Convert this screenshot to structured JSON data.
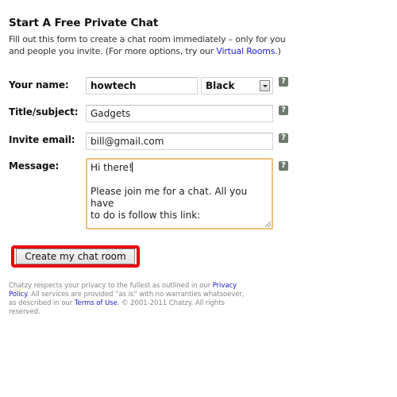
{
  "header": {
    "title": "Start A Free Private Chat",
    "intro_line1": "Fill out this form to create a chat room immediately – only for you",
    "intro_line2_prefix": "and people you invite. (For more options, try our ",
    "intro_link": "Virtual Rooms",
    "intro_line2_suffix": ".)"
  },
  "form": {
    "name": {
      "label": "Your name:",
      "value": "howtech",
      "help_icon": "question-mark-icon"
    },
    "color_select": {
      "selected": "Black",
      "arrow_icon": "chevron-down-icon"
    },
    "title": {
      "label": "Title/subject:",
      "value": "Gadgets"
    },
    "email": {
      "label": "Invite email:",
      "value": "bill@gmail.com"
    },
    "message": {
      "label": "Message:",
      "line1": "Hi there!",
      "line2": "",
      "line3": "Please join me for a chat. All you have",
      "line4": "to do is follow this link:"
    },
    "help_glyph": "?",
    "submit_label": "Create my chat room"
  },
  "colors": {
    "highlight": "#e8000a",
    "link": "#2222cc",
    "focus_border": "#f0c078"
  },
  "footer": {
    "line1_prefix": "Chatzy respects your privacy to the fullest as outlined in our ",
    "privacy_link_part1": "Privacy",
    "privacy_link_part2": "Policy",
    "line2_suffix": ". All services are provided “as is” with no warranties whatsoever,",
    "line3_prefix": "as described in our ",
    "terms_link": "Terms of Use",
    "line3_suffix": ".  © 2001-2011 Chatzy. All rights",
    "line4": "reserved."
  }
}
